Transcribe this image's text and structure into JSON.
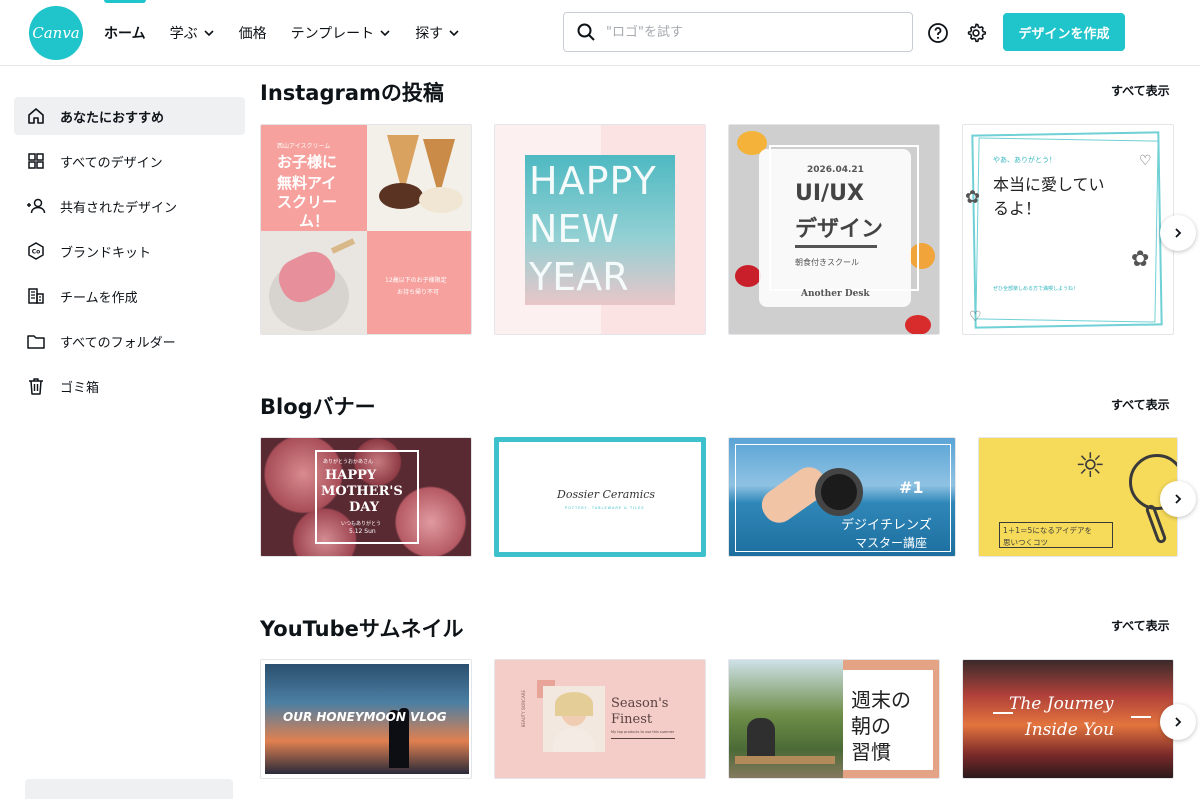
{
  "header": {
    "logo_text": "Canva",
    "nav": [
      {
        "label": "ホーム",
        "dropdown": false
      },
      {
        "label": "学ぶ",
        "dropdown": true
      },
      {
        "label": "価格",
        "dropdown": false
      },
      {
        "label": "テンプレート",
        "dropdown": true
      },
      {
        "label": "探す",
        "dropdown": true
      }
    ],
    "search_placeholder": "\"ロゴ\"を試す",
    "create_button": "デザインを作成",
    "accent_color": "#20c4cb"
  },
  "sidebar": {
    "items": [
      {
        "label": "あなたにおすすめ",
        "icon": "home-icon",
        "active": true
      },
      {
        "label": "すべてのデザイン",
        "icon": "grid-icon",
        "active": false
      },
      {
        "label": "共有されたデザイン",
        "icon": "shared-users-icon",
        "active": false
      },
      {
        "label": "ブランドキット",
        "icon": "brand-kit-icon",
        "active": false
      },
      {
        "label": "チームを作成",
        "icon": "team-building-icon",
        "active": false
      },
      {
        "label": "すべてのフォルダー",
        "icon": "folder-icon",
        "active": false
      },
      {
        "label": "ゴミ箱",
        "icon": "trash-icon",
        "active": false
      }
    ]
  },
  "sections": [
    {
      "title": "Instagramの投稿",
      "see_all": "すべて表示",
      "cards": [
        {
          "texts": [
            "西山アイスクリーム",
            "お子様に",
            "無料アイ",
            "スクリー",
            "ム！",
            "12歳以下のお子様限定",
            "お持ち帰り不可"
          ]
        },
        {
          "texts": [
            "HAPPY",
            "NEW",
            "YEAR"
          ]
        },
        {
          "texts": [
            "2026.04.21",
            "UI/UX",
            "デザイン",
            "朝食付きスクール",
            "Another Desk"
          ]
        },
        {
          "texts": [
            "やあ、ありがとう！",
            "本当に愛してい",
            "るよ！",
            "ぜひ全部楽しめる方で満喫しようね！"
          ]
        }
      ]
    },
    {
      "title": "Blogバナー",
      "see_all": "すべて表示",
      "cards": [
        {
          "texts": [
            "ありがとうおかあさん",
            "HAPPY",
            "MOTHER'S",
            "DAY",
            "いつもありがとう",
            "5.12 Sun"
          ]
        },
        {
          "texts": [
            "Dossier Ceramics",
            "POTTERY, TABLEWARE & TILES"
          ]
        },
        {
          "texts": [
            "#1",
            "デジイチレンズ",
            "マスター講座"
          ]
        },
        {
          "texts": [
            "1＋1＝5になるアイデアを",
            "思いつくコツ"
          ]
        }
      ]
    },
    {
      "title": "YouTubeサムネイル",
      "see_all": "すべて表示",
      "cards": [
        {
          "texts": [
            "OUR HONEYMOON VLOG"
          ]
        },
        {
          "texts": [
            "BEAUTY SKINCARE",
            "Season's",
            "Finest",
            "My top products to use this summer"
          ]
        },
        {
          "texts": [
            "週末の",
            "朝の",
            "習慣"
          ]
        },
        {
          "texts": [
            "The Journey",
            "Inside You"
          ]
        }
      ]
    }
  ]
}
